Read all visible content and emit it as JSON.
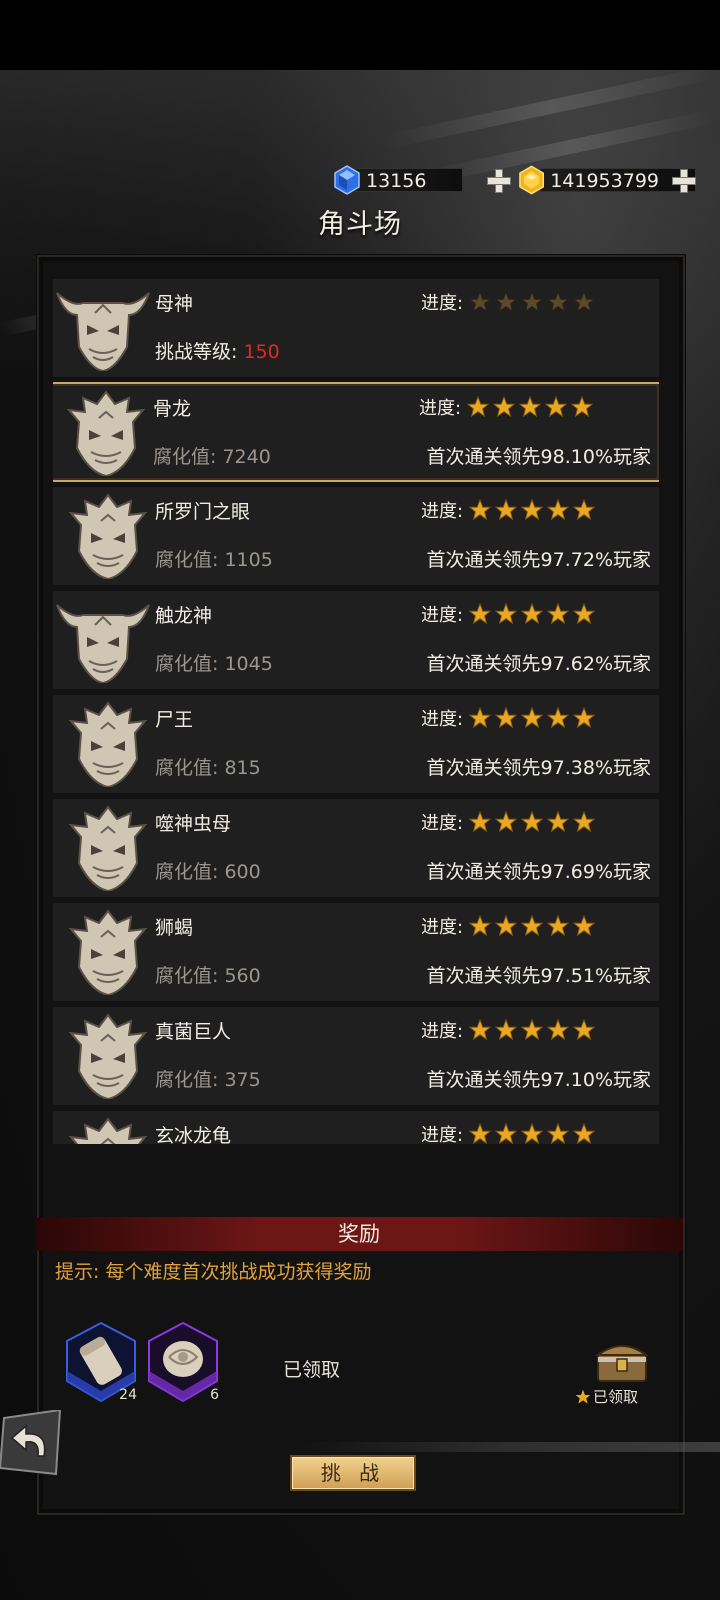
{
  "header": {
    "diamonds": "13156",
    "gold": "141953799",
    "title": "角斗场"
  },
  "list": {
    "progress_label": "进度:",
    "rows": [
      {
        "name": "母神",
        "sub_label": "挑战等级: ",
        "sub_value": "150",
        "stars_filled": 0,
        "first_clear": "",
        "mask": "horned",
        "selected": false
      },
      {
        "name": "骨龙",
        "sub_label": "腐化值:",
        "sub_value": "7240",
        "stars_filled": 5,
        "first_clear": "首次通关领先98.10%玩家",
        "mask": "spiked",
        "selected": true
      },
      {
        "name": "所罗门之眼",
        "sub_label": "腐化值:",
        "sub_value": "1105",
        "stars_filled": 5,
        "first_clear": "首次通关领先97.72%玩家",
        "mask": "spiked",
        "selected": false
      },
      {
        "name": "触龙神",
        "sub_label": "腐化值:",
        "sub_value": "1045",
        "stars_filled": 5,
        "first_clear": "首次通关领先97.62%玩家",
        "mask": "horned",
        "selected": false
      },
      {
        "name": "尸王",
        "sub_label": "腐化值:",
        "sub_value": "815",
        "stars_filled": 5,
        "first_clear": "首次通关领先97.38%玩家",
        "mask": "spiked",
        "selected": false
      },
      {
        "name": "噬神虫母",
        "sub_label": "腐化值:",
        "sub_value": "600",
        "stars_filled": 5,
        "first_clear": "首次通关领先97.69%玩家",
        "mask": "spiked",
        "selected": false
      },
      {
        "name": "狮蝎",
        "sub_label": "腐化值:",
        "sub_value": "560",
        "stars_filled": 5,
        "first_clear": "首次通关领先97.51%玩家",
        "mask": "spiked",
        "selected": false
      },
      {
        "name": "真菌巨人",
        "sub_label": "腐化值:",
        "sub_value": "375",
        "stars_filled": 5,
        "first_clear": "首次通关领先97.10%玩家",
        "mask": "spiked",
        "selected": false
      },
      {
        "name": "玄冰龙龟",
        "sub_label": "",
        "sub_value": "",
        "stars_filled": 5,
        "first_clear": "",
        "mask": "spiked",
        "selected": false
      }
    ]
  },
  "reward": {
    "title": "奖励",
    "hint": "提示: 每个难度首次挑战成功获得奖励",
    "items": [
      {
        "icon": "scroll-icon",
        "count": "24",
        "rarity_color": "#2f47c8"
      },
      {
        "icon": "fossil-icon",
        "count": "6",
        "rarity_color": "#7b2fc8"
      }
    ],
    "claimed_text": "已领取",
    "chest_label": "已领取"
  },
  "challenge_button": "挑 战",
  "colors": {
    "star_gold": "#e9a821",
    "star_dim": "#5a4a2a",
    "selected_border": "#c9a869",
    "level_red": "#e12a1f"
  }
}
